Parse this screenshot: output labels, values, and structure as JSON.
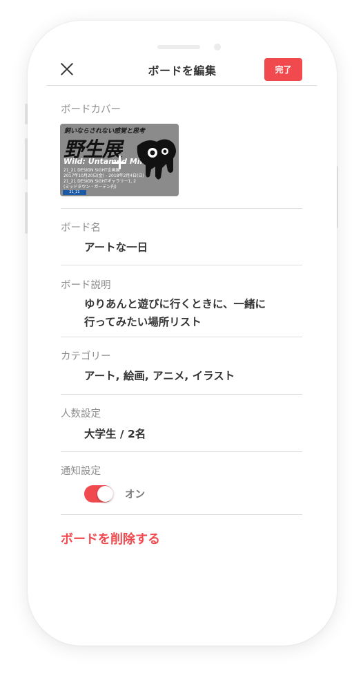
{
  "header": {
    "title": "ボードを編集",
    "done_label": "完了"
  },
  "cover": {
    "label": "ボードカバー",
    "image": {
      "subtitle": "飼いならされない感覚と思考",
      "title": "野生展",
      "title_en": "Wild: Untamed Mind",
      "info": [
        "21_21 DESIGN SIGHT企画展",
        "2017年10月20日(金) - 2018年2月4日(日)",
        "21_21 DESIGN SIGHTギャラリー1, 2",
        "(ミッドタウン・ガーデン内)"
      ],
      "logo": "21_21"
    }
  },
  "board_name": {
    "label": "ボード名",
    "value": "アートな一日"
  },
  "board_description": {
    "label": "ボード説明",
    "lines": [
      "ゆりあんと遊びに行くときに、一緒に",
      "行ってみたい場所リスト"
    ]
  },
  "category": {
    "label": "カテゴリー",
    "value": "アート, 絵画, アニメ, イラスト"
  },
  "people": {
    "label": "人数設定",
    "value": "大学生 / 2名"
  },
  "notification": {
    "label": "通知設定",
    "toggle_state": "on",
    "toggle_label": "オン"
  },
  "delete": {
    "label": "ボードを削除する"
  },
  "colors": {
    "accent": "#f04a4f",
    "text": "#333333",
    "label": "#8e8e8e",
    "separator": "#dcdcdc"
  }
}
